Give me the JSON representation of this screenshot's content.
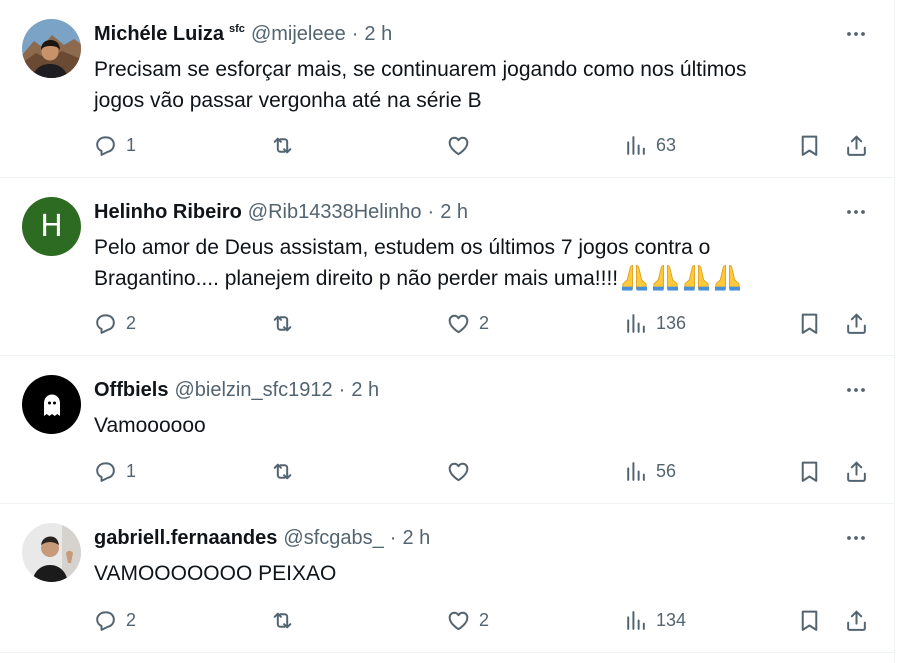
{
  "tweets": [
    {
      "name": "Michéle Luiza",
      "badge": "sfc",
      "handle": "@mijeleee",
      "separator": "·",
      "time": "2 h",
      "lines": [
        "Precisam se esforçar mais, se continuarem jogando como nos últimos",
        "jogos vão passar vergonha até na série B"
      ],
      "replies": "1",
      "retweets": "",
      "likes": "",
      "views": "63"
    },
    {
      "name": "Helinho Ribeiro",
      "avatar_letter": "H",
      "handle": "@Rib14338Helinho",
      "separator": "·",
      "time": "2 h",
      "lines": [
        "Pelo amor de Deus assistam, estudem os últimos 7 jogos contra o",
        "Bragantino.... planejem direito p não perder mais uma!!!!"
      ],
      "emoji": "folded-hands",
      "emoji_count": 4,
      "replies": "2",
      "retweets": "",
      "likes": "2",
      "views": "136"
    },
    {
      "name": "Offbiels",
      "handle": "@bielzin_sfc1912",
      "separator": "·",
      "time": "2 h",
      "lines": [
        "Vamoooooo"
      ],
      "replies": "1",
      "retweets": "",
      "likes": "",
      "views": "56"
    },
    {
      "name": "gabriell.fernaandes",
      "handle": "@sfcgabs_",
      "separator": "·",
      "time": "2 h",
      "lines": [
        "VAMOOOOOOO PEIXAO"
      ],
      "replies": "2",
      "retweets": "",
      "likes": "2",
      "views": "134"
    }
  ],
  "colors": {
    "text_primary": "#0f1419",
    "text_secondary": "#536471",
    "divider": "#eff3f4",
    "avatar_letter_bg": "#2d6b22"
  },
  "icons": [
    "reply-icon",
    "retweet-icon",
    "like-icon",
    "views-icon",
    "bookmark-icon",
    "share-icon",
    "more-icon"
  ]
}
